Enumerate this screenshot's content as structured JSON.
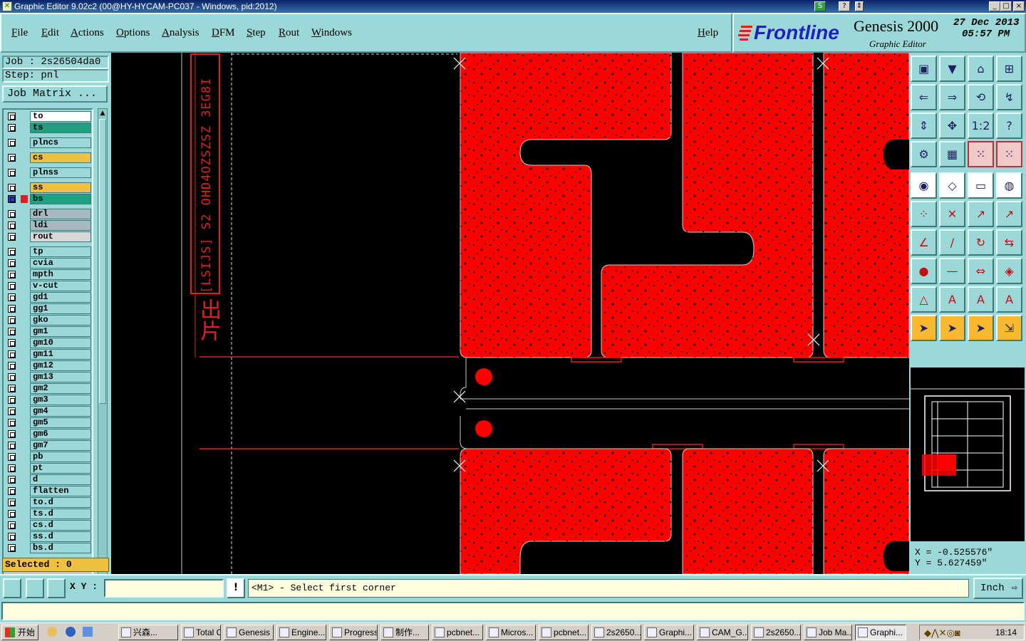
{
  "window": {
    "title": "Graphic Editor 9.02c2 (00@HY-HYCAM-PC037 - Windows, pid:2012)",
    "controls": [
      "_",
      "□",
      "×"
    ]
  },
  "menubar": {
    "items": [
      "File",
      "Edit",
      "Actions",
      "Options",
      "Analysis",
      "DFM",
      "Step",
      "Rout",
      "Windows"
    ],
    "help": "Help"
  },
  "brand": {
    "logo": "Frontline",
    "product": "Genesis 2000",
    "subtitle": "Graphic Editor",
    "date": "27 Dec 2013",
    "time": "05:57 PM"
  },
  "job": {
    "job": "Job : 2s26504da0",
    "step": "Step: pnl",
    "matrix_button": "Job Matrix ..."
  },
  "layers": [
    {
      "name": "to",
      "color": "#ffffff"
    },
    {
      "name": "ts",
      "color": "#20a080"
    },
    {
      "name": "plncs",
      "color": "#9cd8d8"
    },
    {
      "name": "cs",
      "color": "#f0c040"
    },
    {
      "name": "plnss",
      "color": "#9cd8d8"
    },
    {
      "name": "ss",
      "color": "#f0c040"
    },
    {
      "name": "bs",
      "color": "#20a080"
    },
    {
      "name": "drl",
      "color": "#a8b8c0"
    },
    {
      "name": "ldi",
      "color": "#a8b8c0"
    },
    {
      "name": "rout",
      "color": "#d8d8d8"
    },
    {
      "name": "tp",
      "color": "#9cd8d8"
    },
    {
      "name": "cvia",
      "color": "#9cd8d8"
    },
    {
      "name": "mpth",
      "color": "#9cd8d8"
    },
    {
      "name": "v-cut",
      "color": "#9cd8d8"
    },
    {
      "name": "gd1",
      "color": "#9cd8d8"
    },
    {
      "name": "gg1",
      "color": "#9cd8d8"
    },
    {
      "name": "gko",
      "color": "#9cd8d8"
    },
    {
      "name": "gm1",
      "color": "#9cd8d8"
    },
    {
      "name": "gm10",
      "color": "#9cd8d8"
    },
    {
      "name": "gm11",
      "color": "#9cd8d8"
    },
    {
      "name": "gm12",
      "color": "#9cd8d8"
    },
    {
      "name": "gm13",
      "color": "#9cd8d8"
    },
    {
      "name": "gm2",
      "color": "#9cd8d8"
    },
    {
      "name": "gm3",
      "color": "#9cd8d8"
    },
    {
      "name": "gm4",
      "color": "#9cd8d8"
    },
    {
      "name": "gm5",
      "color": "#9cd8d8"
    },
    {
      "name": "gm6",
      "color": "#9cd8d8"
    },
    {
      "name": "gm7",
      "color": "#9cd8d8"
    },
    {
      "name": "pb",
      "color": "#9cd8d8"
    },
    {
      "name": "pt",
      "color": "#9cd8d8"
    },
    {
      "name": "d",
      "color": "#9cd8d8"
    },
    {
      "name": "flatten",
      "color": "#9cd8d8"
    },
    {
      "name": "to.d",
      "color": "#9cd8d8"
    },
    {
      "name": "ts.d",
      "color": "#9cd8d8"
    },
    {
      "name": "cs.d",
      "color": "#9cd8d8"
    },
    {
      "name": "ss.d",
      "color": "#9cd8d8"
    },
    {
      "name": "bs.d",
      "color": "#9cd8d8"
    }
  ],
  "selected": "Selected : 0",
  "canvas": {
    "vertical_text": "[LSIJS] S2 OHD4OZSZSZ 3EG8I",
    "chinese_text": "出片"
  },
  "coords": {
    "x": "X = -0.525576\"",
    "y": "Y = 5.627459\""
  },
  "command": {
    "xy_label": "X Y :",
    "xy_value": "",
    "info_icon": "!",
    "prompt": "<M1> - Select first corner",
    "unit": "Inch"
  },
  "taskbar": {
    "start": "开始",
    "items": [
      "兴森...",
      "Total C...",
      "Genesis",
      "Engine...",
      "Progress",
      "制作...",
      "pcbnet...",
      "Micros...",
      "pcbnet...",
      "2s2650...",
      "Graphi...",
      "CAM_G...",
      "2s2650...",
      "Job Ma...",
      "Graphi..."
    ],
    "clock": "18:14"
  }
}
